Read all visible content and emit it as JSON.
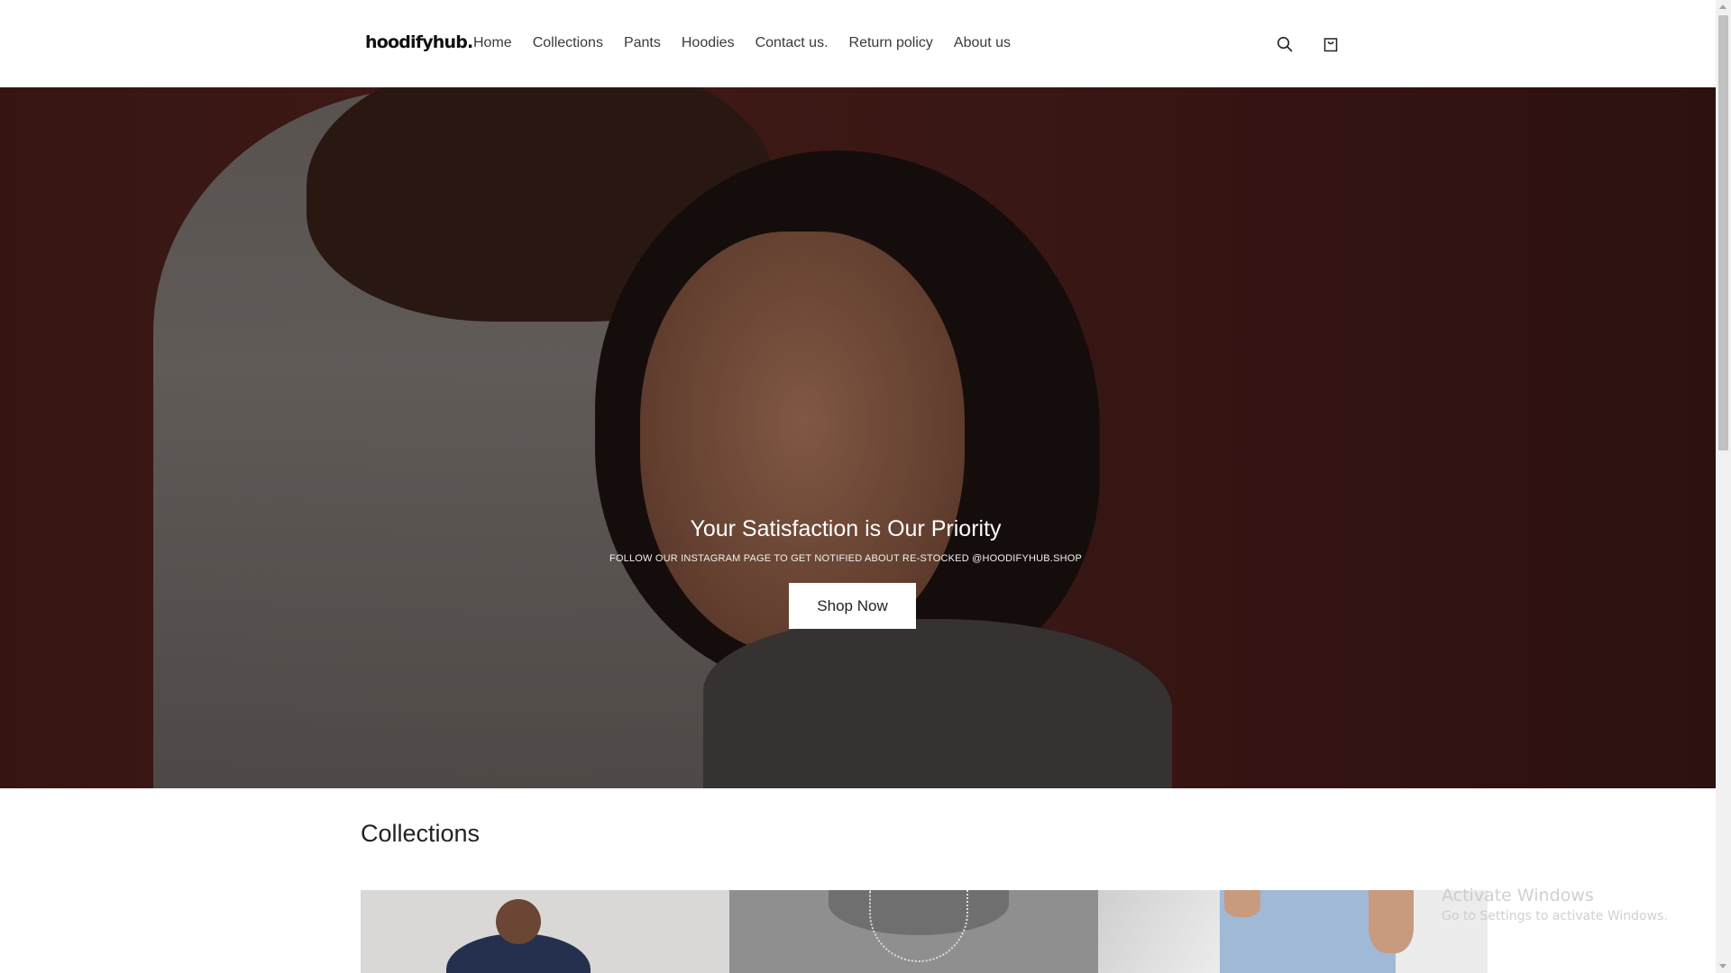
{
  "header": {
    "logo": "hoodifyhub.",
    "nav": [
      {
        "label": "Home"
      },
      {
        "label": "Collections"
      },
      {
        "label": "Pants"
      },
      {
        "label": "Hoodies"
      },
      {
        "label": "Contact us."
      },
      {
        "label": "Return policy"
      },
      {
        "label": "About us"
      }
    ],
    "icons": {
      "search": "search-icon",
      "cart": "cart-icon"
    }
  },
  "hero": {
    "title": "Your Satisfaction is Our Priority",
    "subtitle": "FOLLOW OUR INSTAGRAM PAGE TO GET NOTIFIED ABOUT RE-STOCKED @HOODIFYHUB.SHOP",
    "button_label": "Shop Now",
    "background_color": "#4a1e1a"
  },
  "collections": {
    "heading": "Collections"
  },
  "watermark": {
    "title": "Activate Windows",
    "subtitle": "Go to Settings to activate Windows."
  }
}
